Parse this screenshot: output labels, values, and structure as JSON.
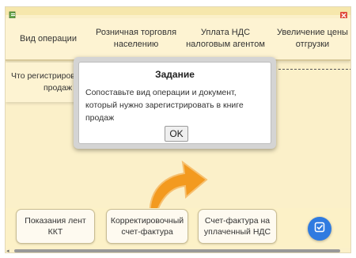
{
  "header": {
    "columns": [
      "Вид операции",
      "Розничная торговля населению",
      "Уплата НДС налоговым агентом",
      "Увеличение цены отгрузки"
    ]
  },
  "rows": {
    "question_label": "Что регистриров в книге продаж"
  },
  "dialog": {
    "title": "Задание",
    "message": "Сопоставьте вид операции и документ, который нужно зарегистрировать в книге продаж",
    "ok_label": "OK"
  },
  "cards": [
    "Показания лент ККТ",
    "Корректировочный счет-фактура",
    "Счет-фактура на уплаченный НДС"
  ],
  "icons": {
    "app": "app-icon",
    "close": "close-icon",
    "check": "check-icon",
    "arrow": "curved-arrow-icon"
  },
  "colors": {
    "background": "#fbf0c9",
    "accent_blue": "#2f7be0",
    "arrow_orange": "#f39a1f"
  }
}
